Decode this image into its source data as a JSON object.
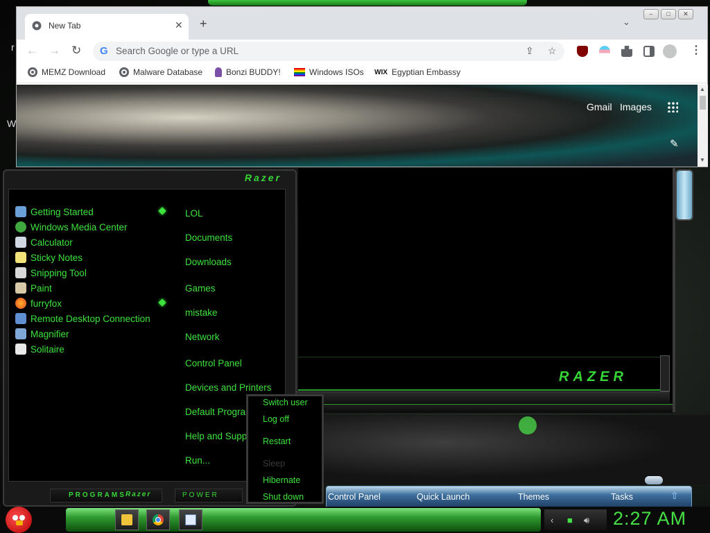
{
  "desktop": {
    "edge_letters": [
      "r",
      "W"
    ]
  },
  "browser": {
    "tab": {
      "title": "New Tab"
    },
    "window_buttons": {
      "minimize": "–",
      "maximize": "□",
      "close": "✕"
    },
    "omnibox": {
      "placeholder": "Search Google or type a URL"
    },
    "bookmarks": [
      {
        "label": "MEMZ Download",
        "icon": "globe-icon"
      },
      {
        "label": "Malware Database",
        "icon": "globe-icon"
      },
      {
        "label": "Bonzi BUDDY!",
        "icon": "bonzi-icon"
      },
      {
        "label": "Windows ISOs",
        "icon": "rainbow-flag-icon"
      },
      {
        "label": "Egyptian Embassy",
        "icon": "wix-icon"
      }
    ],
    "wix_mark": "WIX",
    "content": {
      "gmail": "Gmail",
      "images": "Images"
    }
  },
  "start_menu": {
    "brand": "Razer",
    "programs": [
      {
        "label": "Getting Started",
        "icon": "getting-started-icon",
        "color": "#6aa0d8",
        "pinned": true
      },
      {
        "label": "Windows Media Center",
        "icon": "media-center-icon",
        "color": "#3ea83e",
        "pinned": false
      },
      {
        "label": "Calculator",
        "icon": "calculator-icon",
        "color": "#cfd8e3",
        "pinned": false
      },
      {
        "label": "Sticky Notes",
        "icon": "sticky-notes-icon",
        "color": "#f2e27a",
        "pinned": false
      },
      {
        "label": "Snipping Tool",
        "icon": "snipping-tool-icon",
        "color": "#d8d8d8",
        "pinned": false
      },
      {
        "label": "Paint",
        "icon": "paint-icon",
        "color": "#d8c9a8",
        "pinned": false
      },
      {
        "label": "furryfox",
        "icon": "firefox-icon",
        "color": "#ff7a1a",
        "pinned": true
      },
      {
        "label": "Remote Desktop Connection",
        "icon": "remote-desktop-icon",
        "color": "#5f8fd0",
        "pinned": false
      },
      {
        "label": "Magnifier",
        "icon": "magnifier-icon",
        "color": "#7fa7d8",
        "pinned": false
      },
      {
        "label": "Solitaire",
        "icon": "solitaire-icon",
        "color": "#e8e8e8",
        "pinned": false
      }
    ],
    "places": [
      "LOL",
      "Documents",
      "Downloads",
      "Games",
      "mistake",
      "Network",
      "Control Panel",
      "Devices and Printers",
      "Default Programs",
      "Help and Support",
      "Run..."
    ],
    "footer": {
      "programs_label": "PROGRAMS",
      "brand": "Razer",
      "power_label": "POWER"
    }
  },
  "power_menu": {
    "items": [
      {
        "label": "Switch user",
        "enabled": true
      },
      {
        "label": "Log off",
        "enabled": true
      },
      {
        "label": "Restart",
        "enabled": true
      },
      {
        "label": "Sleep",
        "enabled": false
      },
      {
        "label": "Hibernate",
        "enabled": true
      },
      {
        "label": "Shut down",
        "enabled": true
      }
    ]
  },
  "backdrop": {
    "brand": "RAZER"
  },
  "dock": {
    "items": [
      "Control Panel",
      "Quick Launch",
      "Themes",
      "Tasks"
    ]
  },
  "taskbar": {
    "pinned": [
      {
        "name": "explorer",
        "icon": "folder-icon"
      },
      {
        "name": "chrome",
        "icon": "chrome-icon"
      },
      {
        "name": "document",
        "icon": "document-icon"
      }
    ],
    "clock": "2:27 AM"
  },
  "colors": {
    "accent": "#3ce33c",
    "taskbar_green": "#2e9a2e",
    "clock": "#46e046"
  }
}
